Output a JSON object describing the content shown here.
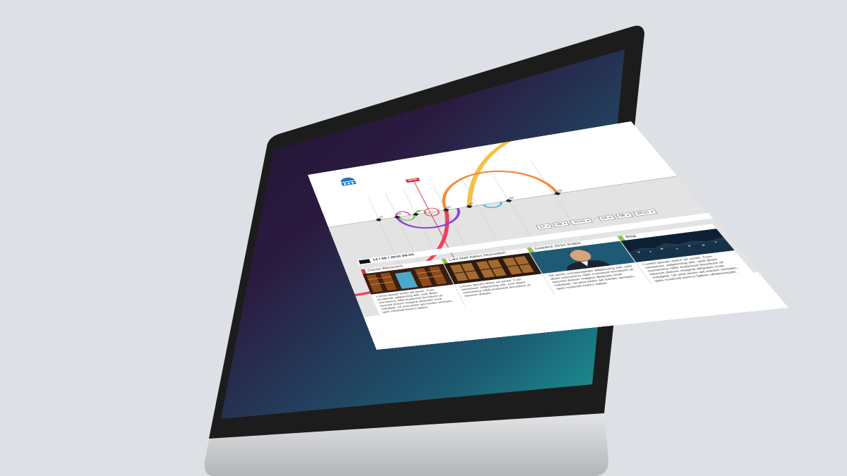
{
  "site": {
    "notify_badge": "NOW",
    "timeline_numbers": [
      "02",
      "05",
      "08",
      "06",
      "07",
      "08",
      "09",
      "10"
    ],
    "date_fields": [
      "12",
      "08",
      "2010",
      "16",
      "08",
      "2010"
    ],
    "date_separator": "-",
    "headline_date": "14 / 08 / 2010 09:55",
    "cards": [
      {
        "title": "Günün Bilmecesi",
        "accent": "#e0303a",
        "image": "library-shelves",
        "body": "Lorem ipsum dolor sit amet. Con sectetuer adipiscing elit, sed diam nonummy nibh euismod tincidunt ut laoreet dolore magna aliquam erat volutpat. Ut wisi enim ad minim veniam, quis nostrud exerci tation."
      },
      {
        "title": "Lahi Mall Adres Hizmetleri",
        "accent": "#8dc63f",
        "image": "wooden-hall",
        "body": "Lorem ipsum dolor sit amet. Con sectetuer adipiscing elit, sed diam nonummy nibh euismod tincidunt ut laoreet dolore."
      },
      {
        "title": "İstanbul 2010 Kültür",
        "accent": "#8dc63f",
        "image": "portrait-man",
        "body": "Sit amet, consectetuer adipiscing elit, sed diam nonummy nibh euismod tincidunt ut laoreet dolore magna aliquam erat volutpat. Ut wisi enim ad minim veniam, quis nostrud exerci tation."
      },
      {
        "title": "Bilgi",
        "accent": "#8dc63f",
        "image": "city-night",
        "body": "Lorem ipsum dolor sit amet. Con sectetuer adipiscing elit, sed diam nonummy nibh euismod tincidunt ut laoreet dolore magna aliquam erat volutpat. Ut wisi enim ad minim veniam, quis nostrud exerci tation ullamcorper."
      }
    ]
  },
  "colors": {
    "arc_yellow": "#f7c042",
    "arc_orange": "#f58a3a",
    "arc_red": "#ee3e5c",
    "arc_purple": "#8b3fd9",
    "arc_blue": "#4db5ea",
    "arc_green": "#6cc04a",
    "arc_magenta": "#d640b8",
    "logo_blue": "#1a73c4",
    "screen_dark": "#1d1430",
    "screen_teal": "#1a8a8e",
    "bezel": "#1c1c1c",
    "aluminum": "#b9bbbd"
  }
}
